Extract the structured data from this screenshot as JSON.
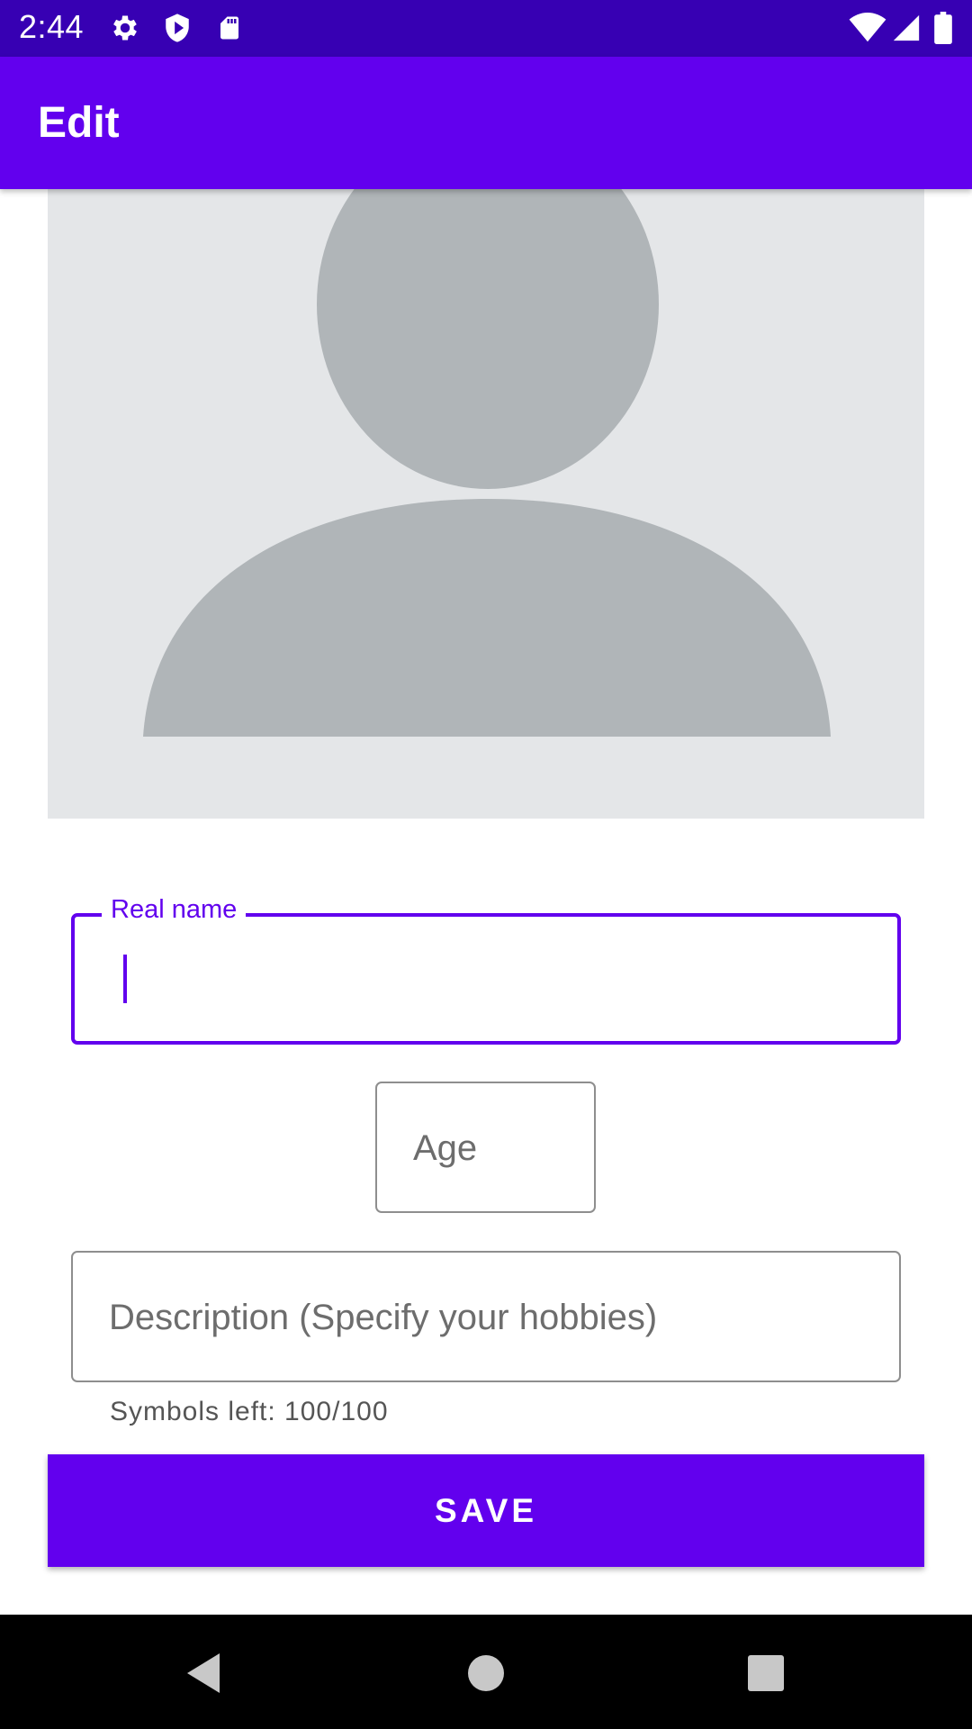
{
  "status_bar": {
    "time": "2:44",
    "left_icons": [
      "gear-icon",
      "shield-play-icon",
      "sd-card-icon"
    ],
    "right_icons": [
      "wifi-icon",
      "cell-signal-icon",
      "battery-icon"
    ]
  },
  "app_bar": {
    "title": "Edit"
  },
  "photo": {
    "icon": "person-placeholder-icon"
  },
  "form": {
    "real_name": {
      "label": "Real name",
      "value": ""
    },
    "age": {
      "placeholder": "Age",
      "value": ""
    },
    "description": {
      "placeholder": "Description (Specify your hobbies)",
      "value": "",
      "helper": "Symbols left: 100/100"
    }
  },
  "save_button": {
    "label": "SAVE"
  },
  "nav_bar": {
    "icons": [
      "back-icon",
      "home-icon",
      "recents-icon"
    ]
  },
  "colors": {
    "status_bar": "#3700b3",
    "primary": "#6200ee",
    "photo_bg": "#e4e6e8",
    "avatar": "#b0b5b8"
  }
}
